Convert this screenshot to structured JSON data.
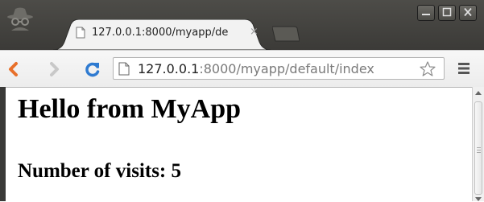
{
  "browser": {
    "tab": {
      "title": "127.0.0.1:8000/myapp/de",
      "close_glyph": "×"
    },
    "address_bar": {
      "host": "127.0.0.1",
      "path": ":8000/myapp/default/index"
    },
    "icons": {
      "incognito": "incognito-icon",
      "back": "back-arrow-icon",
      "forward": "forward-arrow-icon",
      "reload": "reload-icon",
      "page": "page-icon",
      "bookmark": "star-icon",
      "menu": "menu-icon",
      "minimize": "minimize-icon",
      "maximize": "maximize-icon",
      "close": "close-icon"
    },
    "colors": {
      "back_arrow": "#e8702a",
      "reload": "#2f7bd1",
      "frame": "#3b3a37"
    }
  },
  "page": {
    "heading": "Hello from MyApp",
    "visits_label": "Number of visits: 5"
  }
}
